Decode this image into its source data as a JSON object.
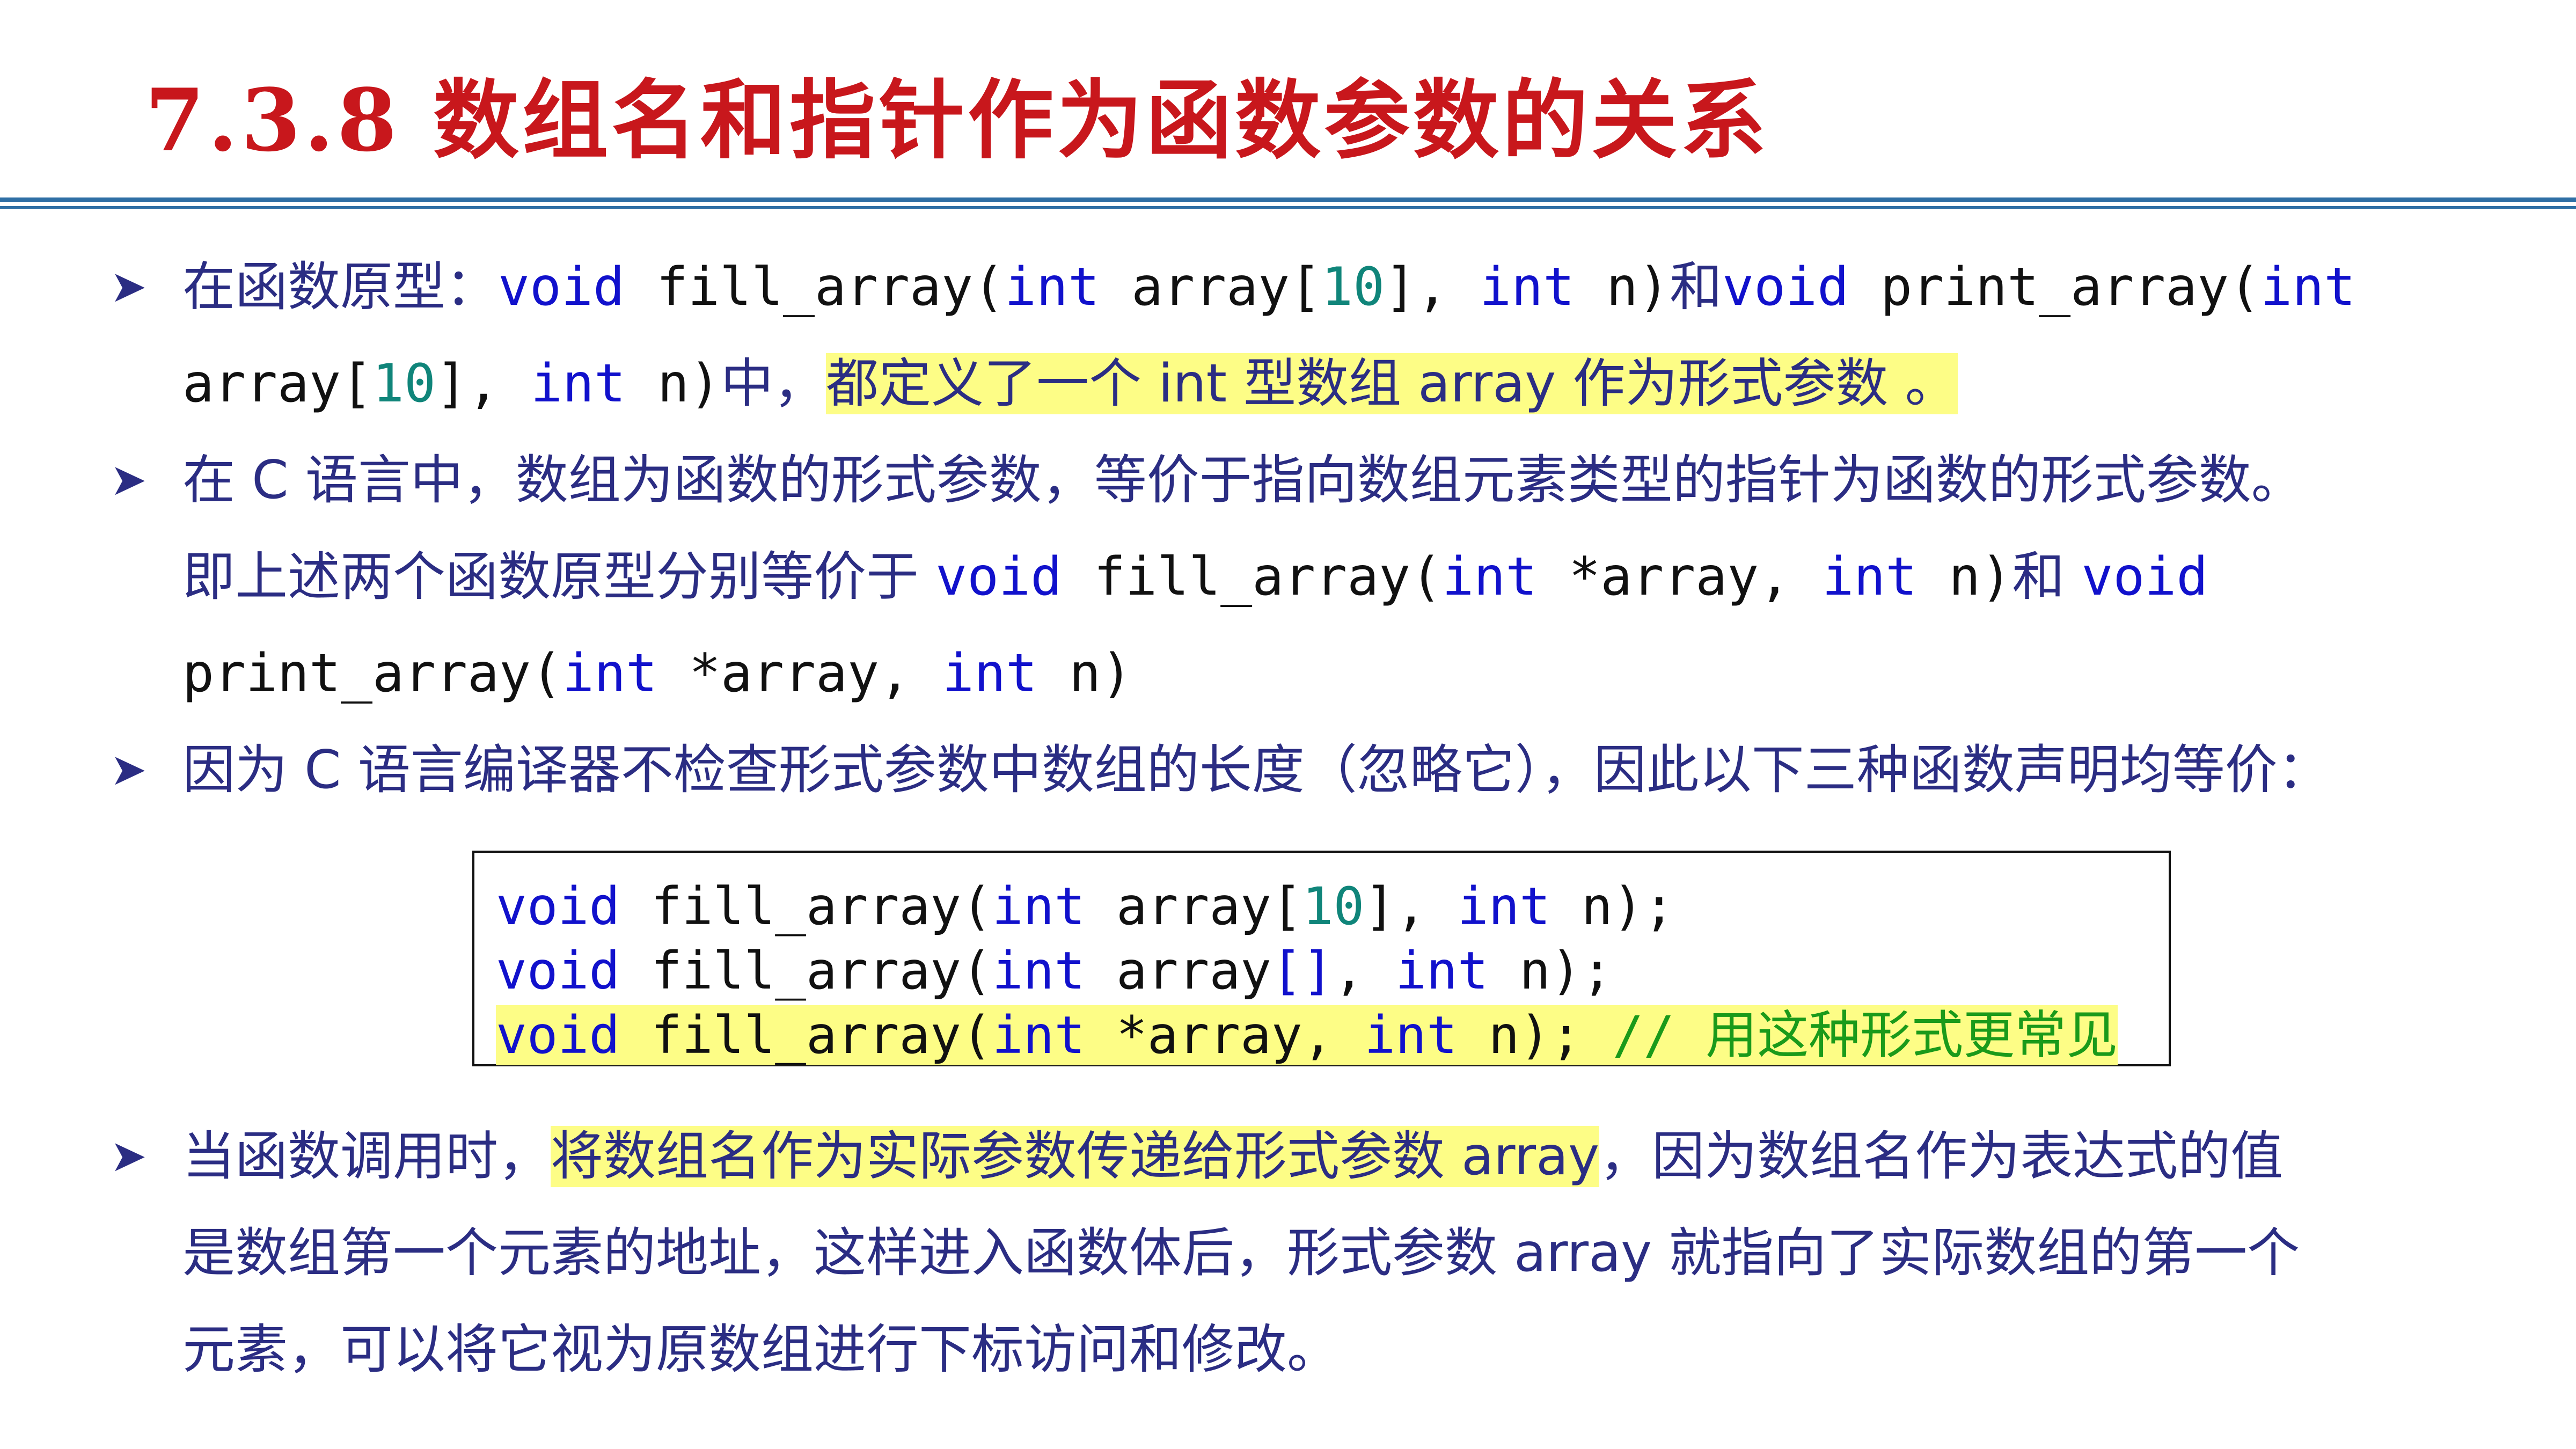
{
  "title": "7.3.8 数组名和指针作为函数参数的关系",
  "bullets": {
    "b1": {
      "prefix": "在函数原型：",
      "kw1": "void",
      "t1": " fill_array(",
      "kw2": "int",
      "t2": " array[",
      "n1": "10",
      "t3": "], ",
      "kw3": "int",
      "t4": " n)",
      "mid": "和",
      "kw4": "void",
      "t5": " print_array(",
      "kw5": "int",
      "l2_t1": "array[",
      "l2_n1": "10",
      "l2_t2": "], ",
      "l2_kw1": "int",
      "l2_t3": " n)",
      "l2_mid": "中，",
      "l2_hl": "都定义了一个 int 型数组 array 作为形式参数 。"
    },
    "b2": {
      "line1": "在 C 语言中，数组为函数的形式参数，等价于指向数组元素类型的指针为函数的形式参数。",
      "l2_pre": "即上述两个函数原型分别等价于 ",
      "l2_kw1": "void",
      "l2_t1": " fill_array(",
      "l2_kw2": "int",
      "l2_t2": " *array, ",
      "l2_kw3": "int",
      "l2_t3": " n)",
      "l2_mid": "和 ",
      "l2_kw4": "void",
      "l3_t1": "print_array(",
      "l3_kw1": "int",
      "l3_t2": " *array, ",
      "l3_kw2": "int",
      "l3_t3": " n)"
    },
    "b3": {
      "line1": "因为 C 语言编译器不检查形式参数中数组的长度（忽略它），因此以下三种函数声明均等价："
    },
    "b4": {
      "l1_pre": "当函数调用时，",
      "l1_hl": "将数组名作为实际参数传递给形式参数 array",
      "l1_post": "，因为数组名作为表达式的值",
      "line2": "是数组第一个元素的地址，这样进入函数体后，形式参数 array 就指向了实际数组的第一个",
      "line3": "元素，可以将它视为原数组进行下标访问和修改。"
    }
  },
  "code": {
    "line1": {
      "kw1": "void",
      "t1": " fill_array(",
      "kw2": "int",
      "t2": " array[",
      "num": "10",
      "t3": "], ",
      "kw3": "int",
      "t4": " n);"
    },
    "line2": {
      "kw1": "void",
      "t1": " fill_array(",
      "kw2": "int",
      "t2": " array",
      "br": "[]",
      "t3": ", ",
      "kw3": "int",
      "t4": " n);"
    },
    "line3": {
      "kw1": "void",
      "t1": " fill_array(",
      "kw2": "int",
      "t2": " *array, ",
      "kw3": "int",
      "t3": " n);",
      "comment": " // 用这种形式更常见"
    }
  },
  "bullet_icon": "arrow-bullet-icon",
  "colors": {
    "title": "#c8171c",
    "text": "#2b2d83",
    "keyword": "#1111cc",
    "number": "#10857a",
    "comment": "#1a9a1a",
    "highlight": "#fdfd86",
    "rule": "#2f6fa5"
  }
}
